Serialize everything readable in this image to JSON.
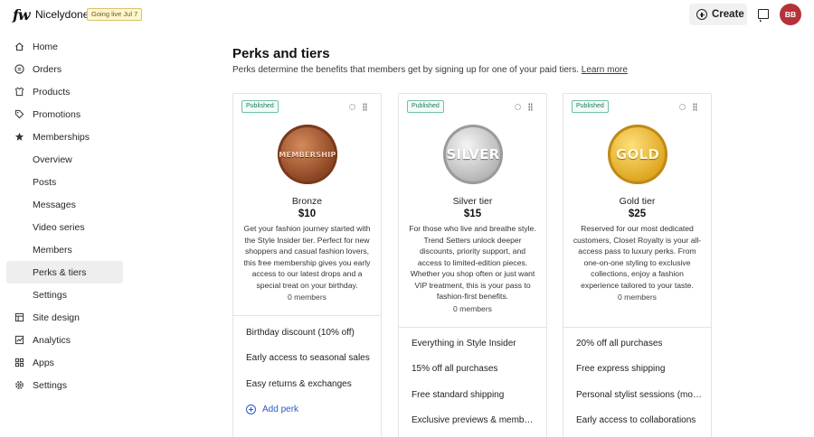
{
  "app": {
    "logo": "fw",
    "site_name": "Nicelydone",
    "live_badge": "Going live Jul 7"
  },
  "header": {
    "create_label": "Create",
    "avatar_initials": "BB"
  },
  "sidebar": {
    "items": [
      {
        "label": "Home",
        "icon": "home-icon"
      },
      {
        "label": "Orders",
        "icon": "orders-icon"
      },
      {
        "label": "Products",
        "icon": "products-icon"
      },
      {
        "label": "Promotions",
        "icon": "tag-icon"
      },
      {
        "label": "Memberships",
        "icon": "star-icon"
      },
      {
        "label": "Overview"
      },
      {
        "label": "Posts"
      },
      {
        "label": "Messages"
      },
      {
        "label": "Video series"
      },
      {
        "label": "Members"
      },
      {
        "label": "Perks & tiers"
      },
      {
        "label": "Settings"
      },
      {
        "label": "Site design",
        "icon": "layout-icon"
      },
      {
        "label": "Analytics",
        "icon": "analytics-icon"
      },
      {
        "label": "Apps",
        "icon": "apps-icon"
      },
      {
        "label": "Settings",
        "icon": "gear-icon"
      }
    ]
  },
  "main": {
    "title": "Perks and tiers",
    "subtitle": "Perks determine the benefits that members get by signing up for one of your paid tiers.",
    "learn_more": "Learn more",
    "tiers": [
      {
        "status": "Published",
        "medal_text": "MEMBERSHIP",
        "name": "Bronze",
        "price": "$10",
        "description": "Get your fashion journey started with the Style Insider tier. Perfect for new shoppers and casual fashion lovers, this free membership gives you early access to our latest drops and a special treat on your birthday.",
        "members": "0 members",
        "perks": [
          "Birthday discount (10% off)",
          "Early access to seasonal sales",
          "Easy returns & exchanges"
        ],
        "add_perk": "Add perk"
      },
      {
        "status": "Published",
        "medal_text": "SILVER",
        "name": "Silver tier",
        "price": "$15",
        "description": "For those who live and breathe style. Trend Setters unlock deeper discounts, priority support, and access to limited-edition pieces. Whether you shop often or just want VIP treatment, this is your pass to fashion-first benefits.",
        "members": "0 members",
        "perks": [
          "Everything in Style Insider",
          "15% off all purchases",
          "Free standard shipping",
          "Exclusive previews & member events"
        ]
      },
      {
        "status": "Published",
        "medal_text": "GOLD",
        "name": "Gold tier",
        "price": "$25",
        "description": "Reserved for our most dedicated customers, Closet Royalty is your all-access pass to luxury perks. From one-on-one styling to exclusive collections, enjoy a fashion experience tailored to your taste.",
        "members": "0 members",
        "perks": [
          "20% off all purchases",
          "Free express shipping",
          "Personal stylist sessions (monthly)",
          "Early access to collaborations"
        ]
      }
    ]
  }
}
